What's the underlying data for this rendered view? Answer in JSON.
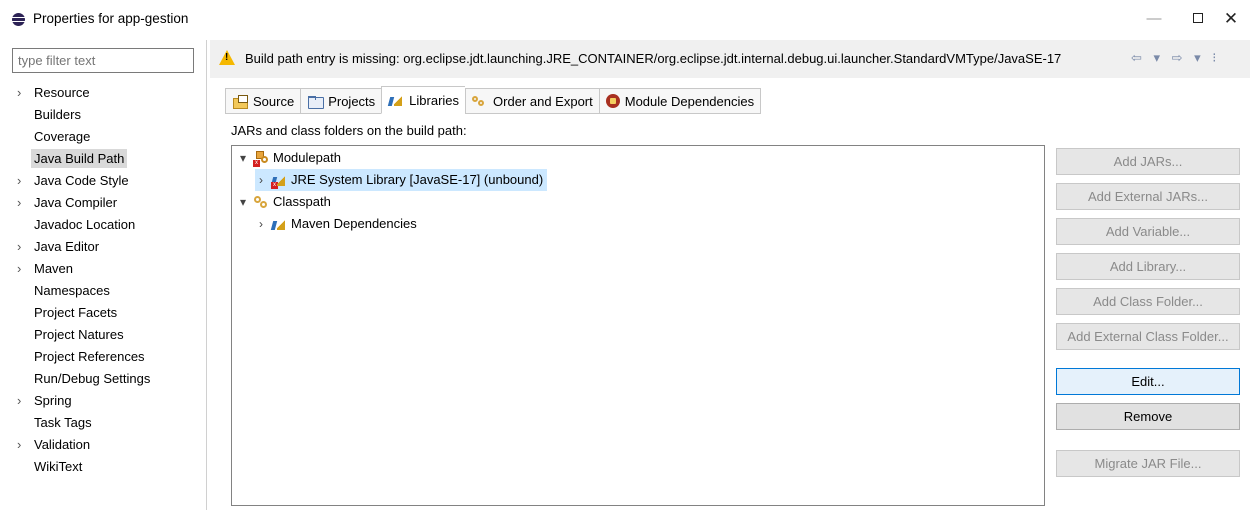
{
  "window": {
    "title": "Properties for app-gestion",
    "minimize": "—",
    "close": "✕"
  },
  "filter": {
    "placeholder": "type filter text"
  },
  "nav": {
    "items": [
      {
        "label": "Resource",
        "expandable": true
      },
      {
        "label": "Builders",
        "expandable": false
      },
      {
        "label": "Coverage",
        "expandable": false
      },
      {
        "label": "Java Build Path",
        "expandable": false,
        "selected": true
      },
      {
        "label": "Java Code Style",
        "expandable": true
      },
      {
        "label": "Java Compiler",
        "expandable": true
      },
      {
        "label": "Javadoc Location",
        "expandable": false
      },
      {
        "label": "Java Editor",
        "expandable": true
      },
      {
        "label": "Maven",
        "expandable": true
      },
      {
        "label": "Namespaces",
        "expandable": false
      },
      {
        "label": "Project Facets",
        "expandable": false
      },
      {
        "label": "Project Natures",
        "expandable": false
      },
      {
        "label": "Project References",
        "expandable": false
      },
      {
        "label": "Run/Debug Settings",
        "expandable": false
      },
      {
        "label": "Spring",
        "expandable": true
      },
      {
        "label": "Task Tags",
        "expandable": false
      },
      {
        "label": "Validation",
        "expandable": true
      },
      {
        "label": "WikiText",
        "expandable": false
      }
    ]
  },
  "message": {
    "text": "Build path entry is missing: org.eclipse.jdt.launching.JRE_CONTAINER/org.eclipse.jdt.internal.debug.ui.launcher.StandardVMType/JavaSE-17",
    "warning_color": "#f5b800"
  },
  "tabs": [
    {
      "label": "Source",
      "icon": "source-folder-icon"
    },
    {
      "label": "Projects",
      "icon": "project-folder-icon"
    },
    {
      "label": "Libraries",
      "icon": "libraries-icon",
      "active": true
    },
    {
      "label": "Order and Export",
      "icon": "order-export-icon"
    },
    {
      "label": "Module Dependencies",
      "icon": "module-dependencies-icon"
    }
  ],
  "section_label": "JARs and class folders on the build path:",
  "tree": {
    "modulepath": "Modulepath",
    "jre": "JRE System Library [JavaSE-17] (unbound)",
    "classpath": "Classpath",
    "maven": "Maven Dependencies"
  },
  "buttons": {
    "add_jars": "Add JARs...",
    "add_external_jars": "Add External JARs...",
    "add_variable": "Add Variable...",
    "add_library": "Add Library...",
    "add_class_folder": "Add Class Folder...",
    "add_external_class_folder": "Add External Class Folder...",
    "edit": "Edit...",
    "remove": "Remove",
    "migrate_jar": "Migrate JAR File..."
  },
  "colors": {
    "selection": "#cce8ff",
    "focus_border": "#0078d7"
  }
}
